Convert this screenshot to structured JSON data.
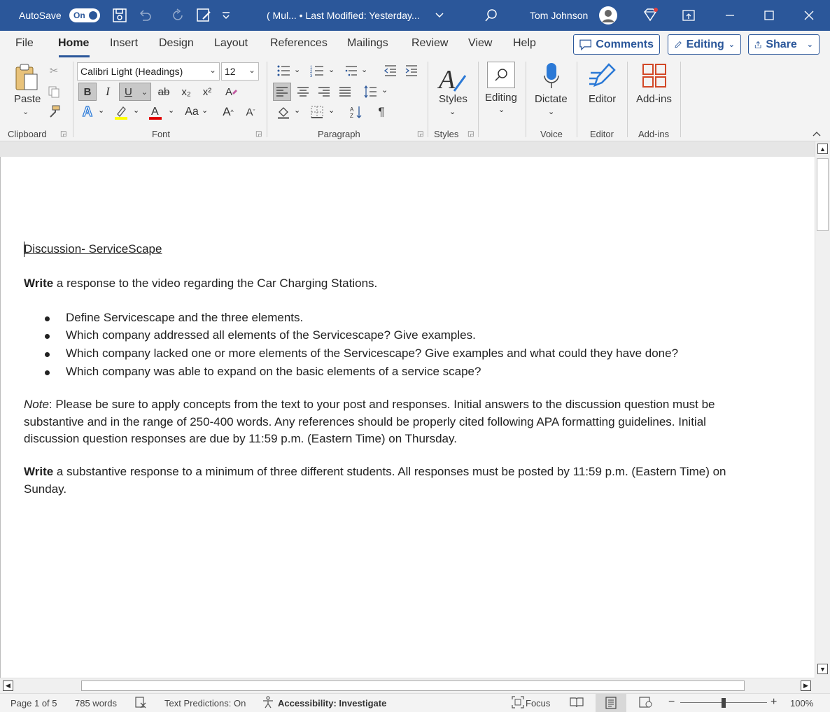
{
  "titlebar": {
    "autosave_label": "AutoSave",
    "autosave_state": "On",
    "doc_title": "( Mul...  •  Last Modified: Yesterday...",
    "user_name": "Tom Johnson"
  },
  "menu": {
    "items": [
      "File",
      "Home",
      "Insert",
      "Design",
      "Layout",
      "References",
      "Mailings",
      "Review",
      "View",
      "Help"
    ],
    "active": "Home",
    "comments_label": "Comments",
    "editing_label": "Editing",
    "share_label": "Share"
  },
  "ribbon": {
    "clipboard": {
      "paste_label": "Paste",
      "group_label": "Clipboard"
    },
    "font": {
      "font_name": "Calibri Light (Headings)",
      "font_size": "12",
      "bold": "B",
      "italic": "I",
      "underline": "U",
      "strike": "ab",
      "subscript": "x₂",
      "superscript": "x²",
      "case_label": "Aa",
      "grow": "A",
      "shrink": "A",
      "group_label": "Font"
    },
    "paragraph": {
      "group_label": "Paragraph",
      "pilcrow": "¶"
    },
    "styles": {
      "label": "Styles",
      "group_label": "Styles"
    },
    "editing": {
      "label": "Editing"
    },
    "voice": {
      "label": "Dictate",
      "group_label": "Voice"
    },
    "editor": {
      "label": "Editor",
      "group_label": "Editor"
    },
    "addins": {
      "label": "Add-ins",
      "group_label": "Add-ins"
    },
    "colors": {
      "accent": "#2b579a",
      "highlight": "#ffff00",
      "font_color": "#e00000",
      "addins": "#d24726"
    }
  },
  "document": {
    "title": "Discussion- ServiceScape",
    "p1_bold": "Write",
    "p1_rest": " a response to the video regarding the Car Charging Stations.",
    "bullets": [
      "Define Servicescape and the three elements.",
      "Which company addressed all elements of the Servicescape? Give examples.",
      "Which company lacked one or more elements of the Servicescape? Give examples and what could they have done?",
      "Which company was able to expand on the basic elements of a service scape?"
    ],
    "note_label": "Note",
    "note_lines": [
      ": Please be sure to apply concepts from the text to your post and responses. Initial answers to the discussion question must be",
      "substantive and in the range of 250-400 words. Any references should be properly cited following APA formatting guidelines. Initial",
      "discussion question responses are due by 11:59 p.m. (Eastern Time) on Thursday."
    ],
    "p3_bold": "Write",
    "p3_line1": " a substantive response to a minimum of three different students. All responses must be posted by 11:59 p.m. (Eastern Time) on",
    "p3_line2": "Sunday."
  },
  "status": {
    "page": "Page 1 of 5",
    "words": "785 words",
    "predictions": "Text Predictions: On",
    "accessibility": "Accessibility: Investigate",
    "focus": "Focus",
    "zoom": "100%"
  }
}
